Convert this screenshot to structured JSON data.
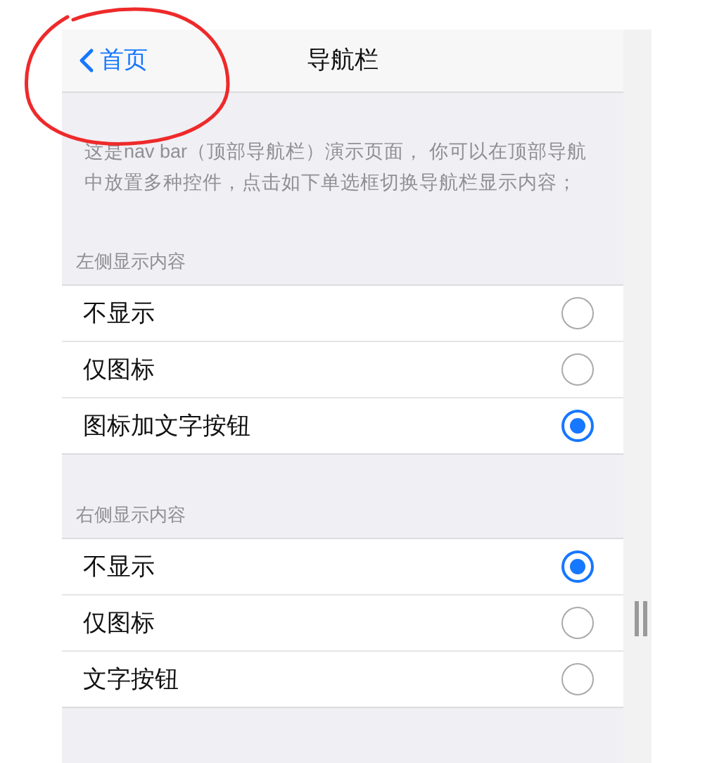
{
  "nav_bar": {
    "back_label": "首页",
    "title": "导航栏"
  },
  "description": "这是nav bar（顶部导航栏）演示页面， 你可以在顶部导航中放置多种控件，点击如下单选框切换导航栏显示内容；",
  "groups": [
    {
      "label": "左侧显示内容",
      "options": [
        {
          "label": "不显示",
          "selected": false
        },
        {
          "label": "仅图标",
          "selected": false
        },
        {
          "label": "图标加文字按钮",
          "selected": true
        }
      ]
    },
    {
      "label": "右侧显示内容",
      "options": [
        {
          "label": "不显示",
          "selected": true
        },
        {
          "label": "仅图标",
          "selected": false
        },
        {
          "label": "文字按钮",
          "selected": false
        }
      ]
    }
  ]
}
